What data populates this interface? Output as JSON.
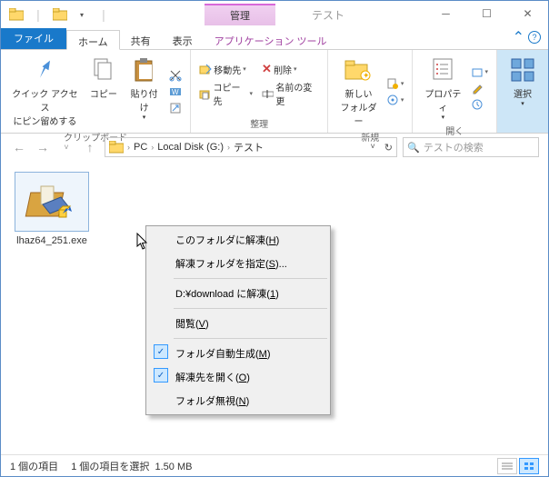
{
  "titlebar": {
    "context_label": "管理",
    "window_title": "テスト"
  },
  "tabs": {
    "file": "ファイル",
    "home": "ホーム",
    "share": "共有",
    "view": "表示",
    "app_tools": "アプリケーション ツール"
  },
  "ribbon": {
    "clipboard": {
      "pin": "クイック アクセス\nにピン留めする",
      "copy": "コピー",
      "paste": "貼り付け",
      "group": "クリップボード"
    },
    "organize": {
      "move_to": "移動先",
      "copy_to": "コピー先",
      "delete": "削除",
      "rename": "名前の変更",
      "group": "整理"
    },
    "new": {
      "new_folder": "新しい\nフォルダー",
      "group": "新規"
    },
    "open": {
      "properties": "プロパティ",
      "group": "開く"
    },
    "select": {
      "select": "選択",
      "group": ""
    }
  },
  "address": {
    "pc": "PC",
    "disk": "Local Disk (G:)",
    "folder": "テスト"
  },
  "search": {
    "placeholder": "テストの検索"
  },
  "file": {
    "name": "lhaz64_251.exe"
  },
  "menu": {
    "m1": "このフォルダに解凍(H)",
    "m2": "解凍フォルダを指定(S)...",
    "m3": "D:¥download に解凍(1)",
    "m4": "閲覧(V)",
    "m5": "フォルダ自動生成(M)",
    "m6": "解凍先を開く(O)",
    "m7": "フォルダ無視(N)"
  },
  "status": {
    "items": "1 個の項目",
    "selected": "1 個の項目を選択",
    "size": "1.50 MB"
  }
}
